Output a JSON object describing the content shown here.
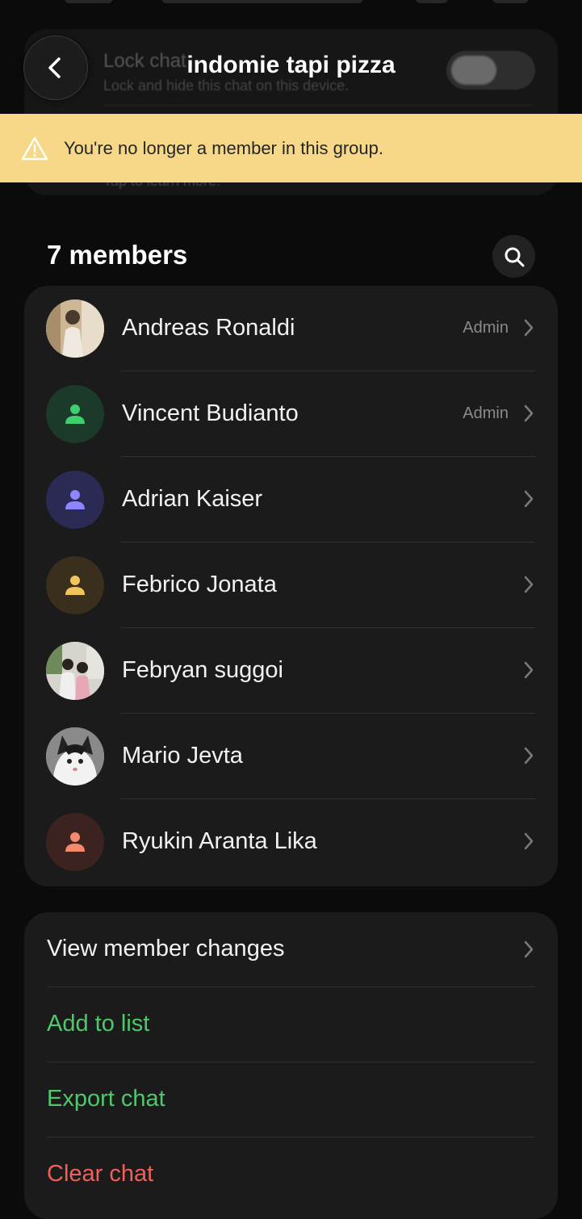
{
  "header": {
    "title": "indomie tapi pizza"
  },
  "background": {
    "lock_title": "Lock chat",
    "lock_subtitle": "Lock and hide this chat on this device.",
    "info_subtitle": "Tap to learn more."
  },
  "banner": {
    "text": "You're no longer a member in this group.",
    "color": "#f6d888"
  },
  "members": {
    "heading": "7 members",
    "list": [
      {
        "name": "Andreas Ronaldi",
        "role": "Admin",
        "avatar": "photo"
      },
      {
        "name": "Vincent Budianto",
        "role": "Admin",
        "avatar": "person-icon",
        "bg": "#1c3a2a",
        "fg": "#3ecf6e"
      },
      {
        "name": "Adrian Kaiser",
        "role": "",
        "avatar": "person-icon",
        "bg": "#2a2a55",
        "fg": "#8f85ff"
      },
      {
        "name": "Febrico Jonata",
        "role": "",
        "avatar": "person-icon",
        "bg": "#3a2e1c",
        "fg": "#f2c55c"
      },
      {
        "name": "Febryan suggoi",
        "role": "",
        "avatar": "photo"
      },
      {
        "name": "Mario Jevta",
        "role": "",
        "avatar": "photo"
      },
      {
        "name": "Ryukin Aranta Lika",
        "role": "",
        "avatar": "person-icon",
        "bg": "#3d2320",
        "fg": "#f48a6a"
      }
    ]
  },
  "actions": {
    "view_member_changes": "View member changes",
    "add_to_list": "Add to list",
    "export_chat": "Export chat",
    "clear_chat": "Clear chat",
    "green": "#4fc86c",
    "red": "#f0605a"
  }
}
